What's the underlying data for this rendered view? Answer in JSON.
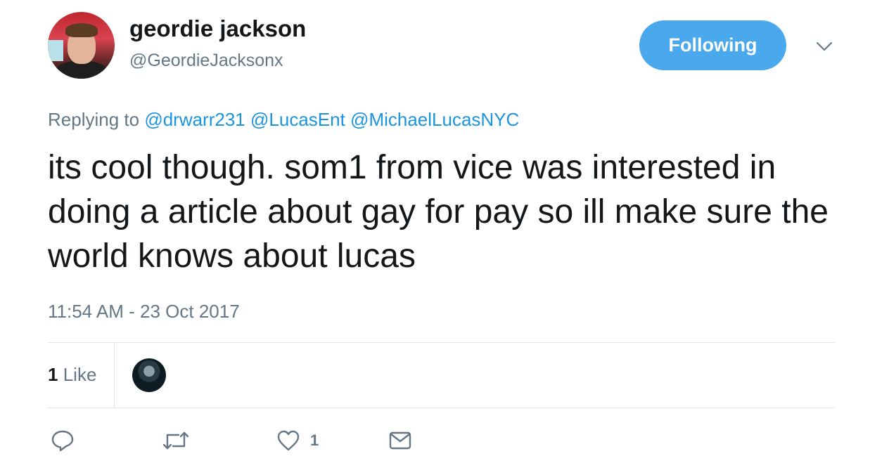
{
  "tweet": {
    "author_name": "geordie jackson",
    "author_handle": "@GeordieJacksonx",
    "follow_button_label": "Following",
    "reply_prefix": "Replying to",
    "reply_to": [
      "@drwarr231",
      "@LucasEnt",
      "@MichaelLucasNYC"
    ],
    "text": "its cool though. som1 from vice was interested in doing a article about gay for pay so ill make sure the world knows about lucas",
    "timestamp": "11:54 AM - 23 Oct 2017",
    "likes_count": "1",
    "likes_label": "Like"
  },
  "actions": {
    "reply_icon": "reply-icon",
    "retweet_icon": "retweet-icon",
    "like_icon": "heart-icon",
    "like_count": "1",
    "dm_icon": "envelope-icon"
  },
  "colors": {
    "accent": "#1b95e0",
    "follow_button_bg": "#4aa8ec",
    "secondary_text": "#657786",
    "primary_text": "#14171a",
    "divider": "#e1e8ed"
  }
}
